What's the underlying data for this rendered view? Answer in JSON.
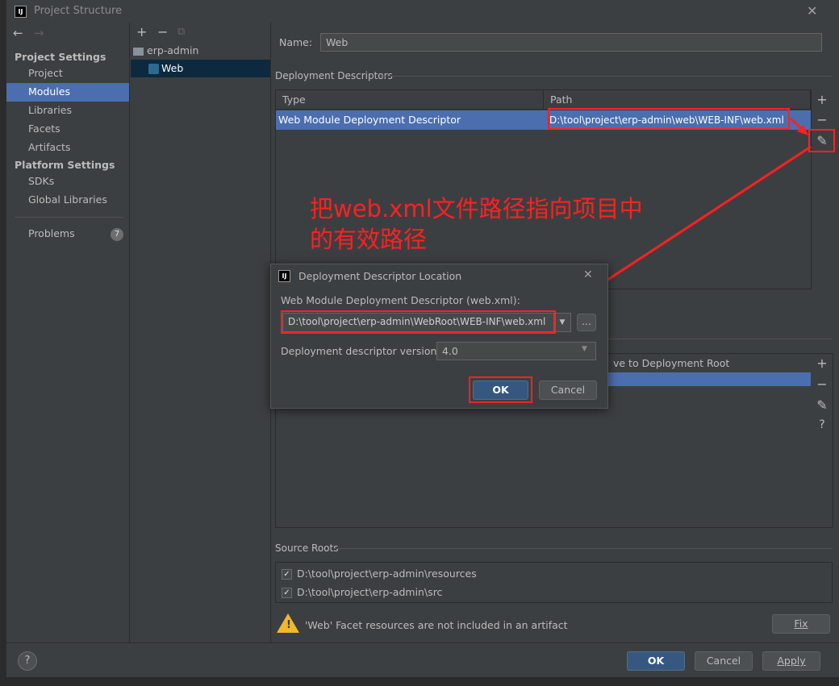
{
  "window": {
    "title": "Project Structure",
    "close_glyph": "✕"
  },
  "nav": {
    "back_glyph": "←",
    "forward_glyph": "→",
    "project_settings_heading": "Project Settings",
    "project_settings_items": [
      "Project",
      "Modules",
      "Libraries",
      "Facets",
      "Artifacts"
    ],
    "platform_settings_heading": "Platform Settings",
    "platform_settings_items": [
      "SDKs",
      "Global Libraries"
    ],
    "problems_label": "Problems",
    "problems_count": "7"
  },
  "tree": {
    "add_glyph": "+",
    "remove_glyph": "−",
    "copy_glyph": "⧉",
    "items": [
      "erp-admin",
      "Web"
    ]
  },
  "main": {
    "name_label": "Name:",
    "name_value": "Web",
    "deployment_descriptors_title": "Deployment Descriptors",
    "col_type": "Type",
    "col_path": "Path",
    "row_type": "Web Module Deployment Descriptor",
    "row_path": "D:\\tool\\project\\erp-admin\\web\\WEB-INF\\web.xml",
    "tool_add": "+",
    "tool_remove": "−",
    "tool_edit": "✎",
    "tool_help": "?",
    "web_root_col": "ve to Deployment Root",
    "annotation_line1": "把web.xml文件路径指向项目中",
    "annotation_line2": "的有效路径",
    "source_roots_title": "Source Roots",
    "source_roots": [
      "D:\\tool\\project\\erp-admin\\resources",
      "D:\\tool\\project\\erp-admin\\src"
    ],
    "warning_text": "'Web' Facet resources are not included in an artifact",
    "fix_label": "Fix"
  },
  "dialog": {
    "title": "Deployment Descriptor Location",
    "descriptor_label": "Web Module Deployment Descriptor (web.xml):",
    "descriptor_value": "D:\\tool\\project\\erp-admin\\WebRoot\\WEB-INF\\web.xml",
    "browse_label": "...",
    "version_label": "Deployment descriptor version",
    "version_value": "4.0",
    "ok_label": "OK",
    "cancel_label": "Cancel",
    "close_glyph": "✕"
  },
  "footer": {
    "help_glyph": "?",
    "ok_label": "OK",
    "cancel_label": "Cancel",
    "apply_label": "Apply"
  },
  "colors": {
    "selection": "#4b6eaf",
    "annotation_red": "#ff2020",
    "background": "#3c3f41"
  }
}
